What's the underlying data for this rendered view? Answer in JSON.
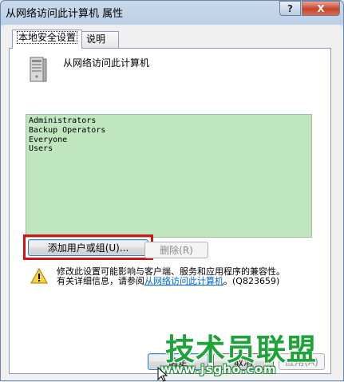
{
  "window": {
    "title": "从网络访问此计算机 属性",
    "help_label": "?",
    "close_label": "X"
  },
  "tabs": [
    {
      "label": "本地安全设置"
    },
    {
      "label": "说明"
    }
  ],
  "policy": {
    "name": "从网络访问此计算机"
  },
  "members": [
    "Administrators",
    "Backup Operators",
    "Everyone",
    "Users"
  ],
  "buttons": {
    "add": "添加用户或组(U)...",
    "remove": "删除(R)",
    "ok": "确定",
    "cancel": "取消",
    "apply": "应用(A)"
  },
  "warning": {
    "line1": "修改此设置可能影响与客户端、服务和应用程序的兼容性。",
    "line2_prefix": "有关详细信息，请参阅",
    "link": "从网络访问此计算机",
    "line2_suffix": "。(Q823659)"
  },
  "watermark": {
    "logo": "技术员联盟",
    "url": "www.jsgho.com"
  },
  "colors": {
    "listbox_bg": "#bfe6bf",
    "highlight": "#d2141a",
    "link": "#0066cc",
    "watermark": "#1ea23a"
  }
}
